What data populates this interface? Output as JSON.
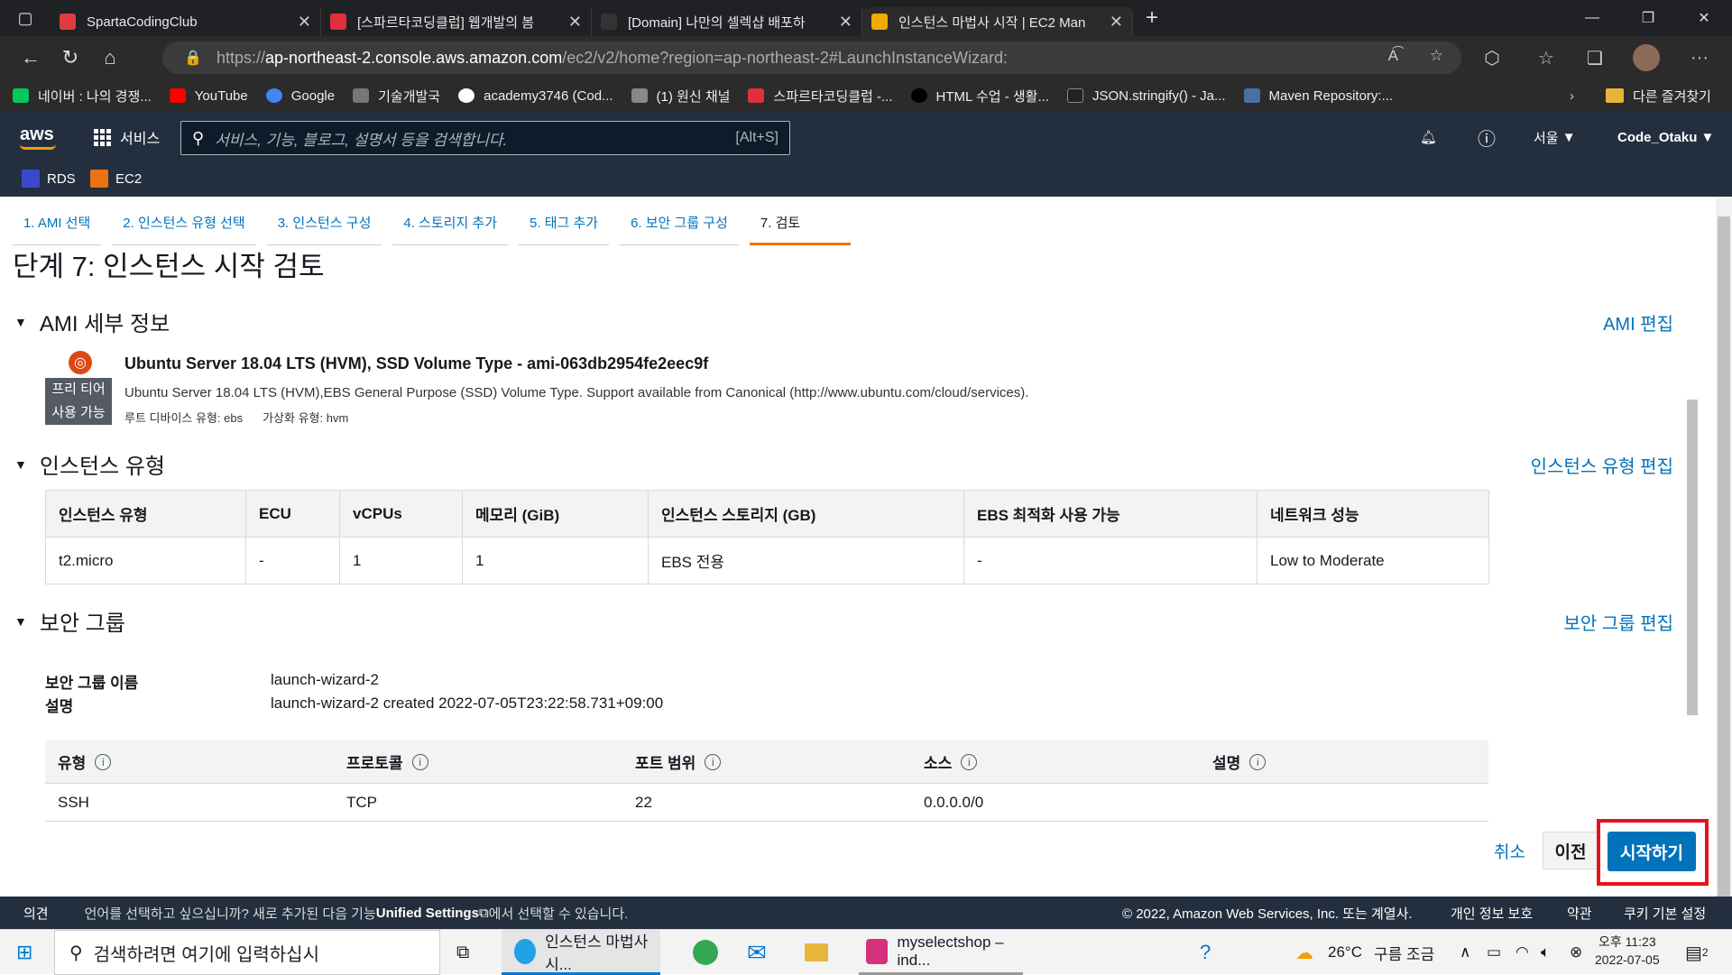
{
  "browser": {
    "tabs": [
      {
        "title": "SpartaCodingClub",
        "color": "#e03a3e"
      },
      {
        "title": "[스파르타코딩클럽] 웹개발의 봄",
        "color": "#e0303a"
      },
      {
        "title": "[Domain] 나만의 셀렉샵 배포하",
        "color": "#333333"
      },
      {
        "title": "인스턴스 마법사 시작 | EC2 Man",
        "color": "#f2a900"
      }
    ],
    "url_prefix": "https://",
    "url_host": "ap-northeast-2.console.aws.amazon.com",
    "url_path": "/ec2/v2/home?region=ap-northeast-2#LaunchInstanceWizard:",
    "bookmarks": [
      {
        "label": "네이버 : 나의 경쟁...",
        "color": "#03c75a"
      },
      {
        "label": "YouTube",
        "color": "#ff0000"
      },
      {
        "label": "Google",
        "color": "#4285f4"
      },
      {
        "label": "기술개발국",
        "color": "#777777"
      },
      {
        "label": "academy3746 (Cod...",
        "color": "#ffffff"
      },
      {
        "label": "(1) 원신 채널",
        "color": "#888888"
      },
      {
        "label": "스파르타코딩클럽 -...",
        "color": "#e0303a"
      },
      {
        "label": "HTML 수업 - 생활...",
        "color": "#000000"
      },
      {
        "label": "JSON.stringify() - Ja...",
        "color": "#222222"
      },
      {
        "label": "Maven Repository:...",
        "color": "#4a6fa5"
      }
    ],
    "other_bookmarks": "다른 즐겨찾기"
  },
  "aws": {
    "logo": "aws",
    "services": "서비스",
    "search_placeholder": "서비스, 기능, 블로그, 설명서 등을 검색합니다.",
    "search_shortcut": "[Alt+S]",
    "region": "서울",
    "account": "Code_Otaku",
    "favorites": [
      "RDS",
      "EC2"
    ]
  },
  "wizard": {
    "steps": [
      "1. AMI 선택",
      "2. 인스턴스 유형 선택",
      "3. 인스턴스 구성",
      "4. 스토리지 추가",
      "5. 태그 추가",
      "6. 보안 그룹 구성",
      "7. 검토"
    ],
    "title": "단계 7: 인스턴스 시작 검토",
    "ami_section": "AMI 세부 정보",
    "ami_edit": "AMI 편집",
    "ami_name": "Ubuntu Server 18.04 LTS (HVM), SSD Volume Type - ami-063db2954fe2eec9f",
    "ami_desc": "Ubuntu Server 18.04 LTS (HVM),EBS General Purpose (SSD) Volume Type. Support available from Canonical (http://www.ubuntu.com/cloud/services).",
    "free_tier_1": "프리 티어",
    "free_tier_2": "사용 가능",
    "root_device": "루트 디바이스 유형: ebs",
    "virt_type": "가상화 유형: hvm",
    "instance_section": "인스턴스 유형",
    "instance_edit": "인스턴스 유형 편집",
    "instance_headers": [
      "인스턴스 유형",
      "ECU",
      "vCPUs",
      "메모리 (GiB)",
      "인스턴스 스토리지 (GB)",
      "EBS 최적화 사용 가능",
      "네트워크 성능"
    ],
    "instance_row": [
      "t2.micro",
      "-",
      "1",
      "1",
      "EBS 전용",
      "-",
      "Low to Moderate"
    ],
    "sg_section": "보안 그룹",
    "sg_edit": "보안 그룹 편집",
    "sg_name_label": "보안 그룹 이름",
    "sg_name": "launch-wizard-2",
    "sg_desc_label": "설명",
    "sg_desc": "launch-wizard-2 created 2022-07-05T23:22:58.731+09:00",
    "rule_headers": [
      "유형",
      "프로토콜",
      "포트 범위",
      "소스",
      "설명"
    ],
    "rule_row": [
      "SSH",
      "TCP",
      "22",
      "0.0.0.0/0",
      ""
    ],
    "cancel": "취소",
    "previous": "이전",
    "launch": "시작하기"
  },
  "footer": {
    "feedback": "의견",
    "lang_msg_1": "언어를 선택하고 싶으십니까? 새로 추가된 다음 기능",
    "lang_msg_bold": "Unified Settings",
    "lang_msg_2": "에서 선택할 수 있습니다.",
    "copyright": "© 2022, Amazon Web Services, Inc. 또는 계열사.",
    "privacy": "개인 정보 보호",
    "terms": "약관",
    "cookies": "쿠키 기본 설정"
  },
  "taskbar": {
    "search_placeholder": "검색하려면 여기에 입력하십시",
    "edge_app": "인스턴스 마법사 시...",
    "idea_app": "myselectshop – ind...",
    "weather_temp": "26°C",
    "weather_text": "구름 조금",
    "time": "오후 11:23",
    "date": "2022-07-05",
    "notif_count": "2"
  }
}
